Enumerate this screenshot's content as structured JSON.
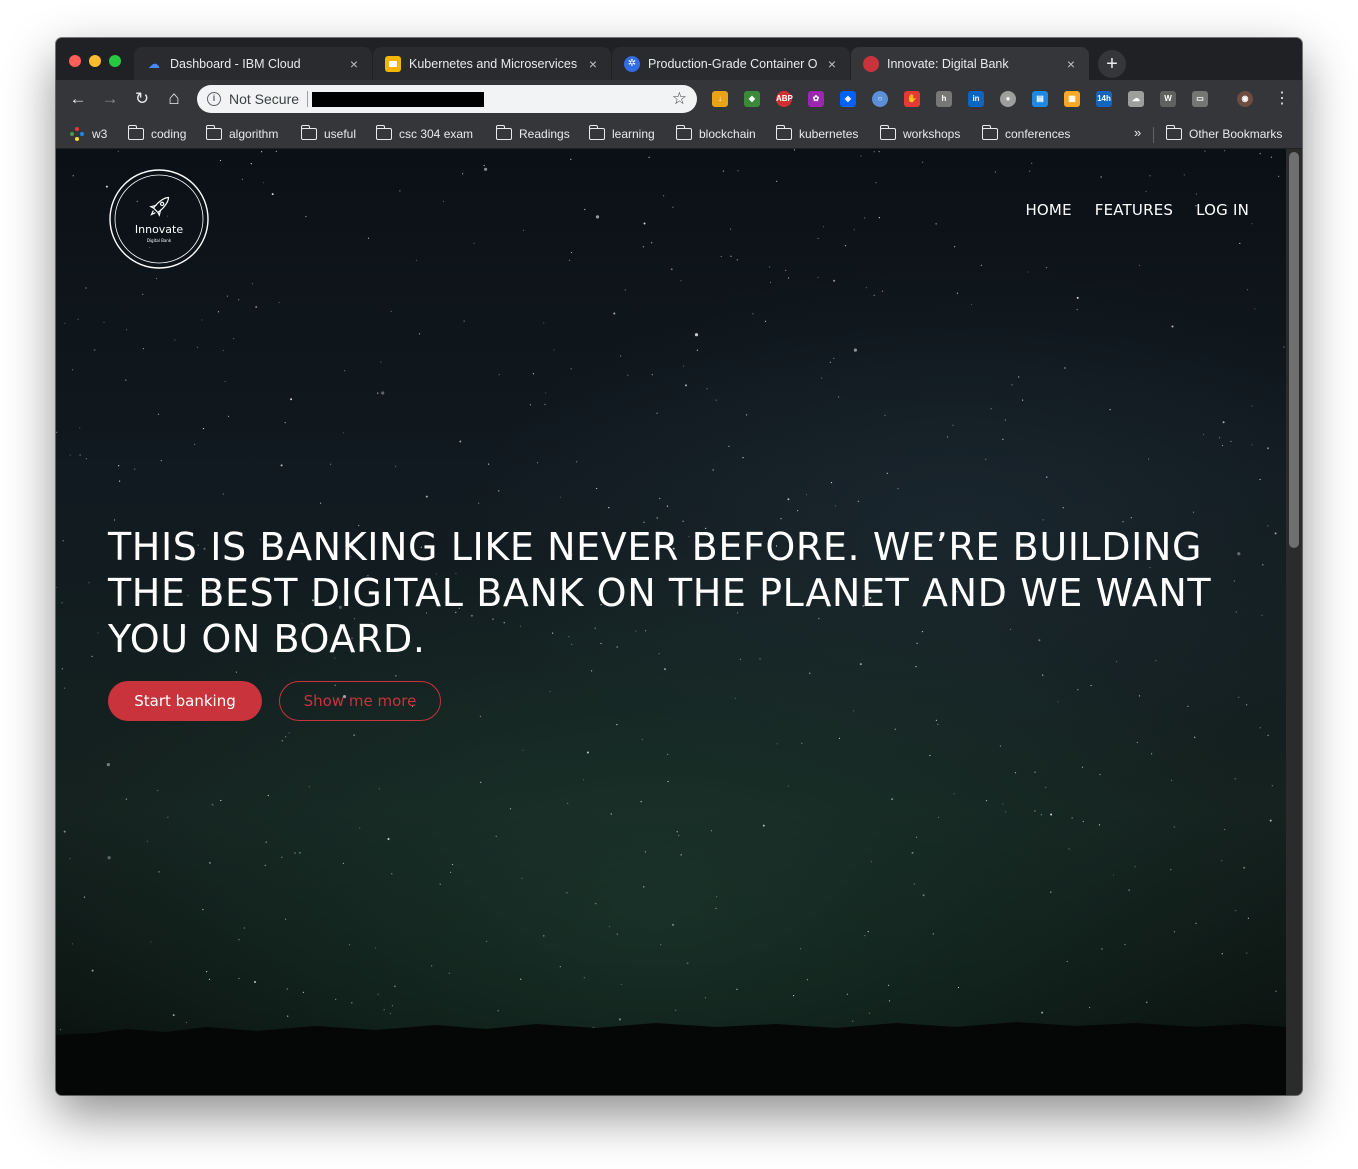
{
  "browser": {
    "tabs": [
      {
        "title": "Dashboard - IBM Cloud",
        "favicon": "ibm-cloud-icon",
        "color": "#4589ff"
      },
      {
        "title": "Kubernetes and Microservices",
        "favicon": "slides-icon",
        "color": "#f4b400"
      },
      {
        "title": "Production-Grade Container O",
        "favicon": "kubernetes-icon",
        "color": "#326ce5"
      },
      {
        "title": "Innovate: Digital Bank",
        "favicon": "innovate-icon",
        "color": "#c8333c"
      }
    ],
    "tab_close": "×",
    "new_tab": "+",
    "address": {
      "security_label": "Not Secure",
      "info_icon": "i",
      "star": "☆"
    },
    "nav": {
      "back": "←",
      "forward": "→",
      "reload": "↻",
      "home": "⌂"
    },
    "extensions": [
      {
        "name": "download-icon",
        "label": "↓",
        "color": "#e8a317"
      },
      {
        "name": "shield-icon",
        "label": "◆",
        "color": "#3a8a3a"
      },
      {
        "name": "adblock-icon",
        "label": "ABP",
        "color": "#d32f2f"
      },
      {
        "name": "color-wheel-icon",
        "label": "✿",
        "color": "#9c27b0"
      },
      {
        "name": "dropbox-icon",
        "label": "◈",
        "color": "#0061fe"
      },
      {
        "name": "circle-icon",
        "label": "○",
        "color": "#5b8fd8"
      },
      {
        "name": "hand-icon",
        "label": "✋",
        "color": "#e53935"
      },
      {
        "name": "h-icon",
        "label": "h",
        "color": "#777777"
      },
      {
        "name": "linkedin-icon",
        "label": "in",
        "color": "#0a66c2"
      },
      {
        "name": "dot-icon",
        "label": "●",
        "color": "#9e9e9e"
      },
      {
        "name": "reader-icon",
        "label": "▤",
        "color": "#1e88e5"
      },
      {
        "name": "calendar-icon",
        "label": "▦",
        "color": "#f9a825"
      },
      {
        "name": "timer-icon",
        "label": "14h",
        "color": "#1565c0"
      },
      {
        "name": "cloud-icon",
        "label": "☁",
        "color": "#9e9e9e"
      },
      {
        "name": "w-icon",
        "label": "W",
        "color": "#616161"
      },
      {
        "name": "window-icon",
        "label": "▭",
        "color": "#757575"
      },
      {
        "name": "profile-avatar-icon",
        "label": "◉",
        "color": "#6d4c41"
      }
    ],
    "menu": "⋮",
    "bookmarks": [
      {
        "label": "w3",
        "type": "w3"
      },
      {
        "label": "coding",
        "type": "folder"
      },
      {
        "label": "algorithm",
        "type": "folder"
      },
      {
        "label": "useful",
        "type": "folder"
      },
      {
        "label": "csc 304 exam",
        "type": "folder"
      },
      {
        "label": "Readings",
        "type": "folder"
      },
      {
        "label": "learning",
        "type": "folder"
      },
      {
        "label": "blockchain",
        "type": "folder"
      },
      {
        "label": "kubernetes",
        "type": "folder"
      },
      {
        "label": "workshops",
        "type": "folder"
      },
      {
        "label": "conferences",
        "type": "folder"
      }
    ],
    "bookmarks_more": "»",
    "other_bookmarks": "Other Bookmarks"
  },
  "site": {
    "logo": {
      "name": "Innovate",
      "tagline": "Digital Bank"
    },
    "nav": {
      "home": "HOME",
      "features": "FEATURES",
      "login": "LOG IN"
    },
    "hero": "THIS IS BANKING LIKE NEVER BEFORE. WE’RE BUILDING THE BEST DIGITAL BANK ON THE PLANET AND WE WANT YOU ON BOARD.",
    "buttons": {
      "primary": "Start banking",
      "secondary": "Show me more"
    },
    "accent_color": "#c8333c"
  }
}
